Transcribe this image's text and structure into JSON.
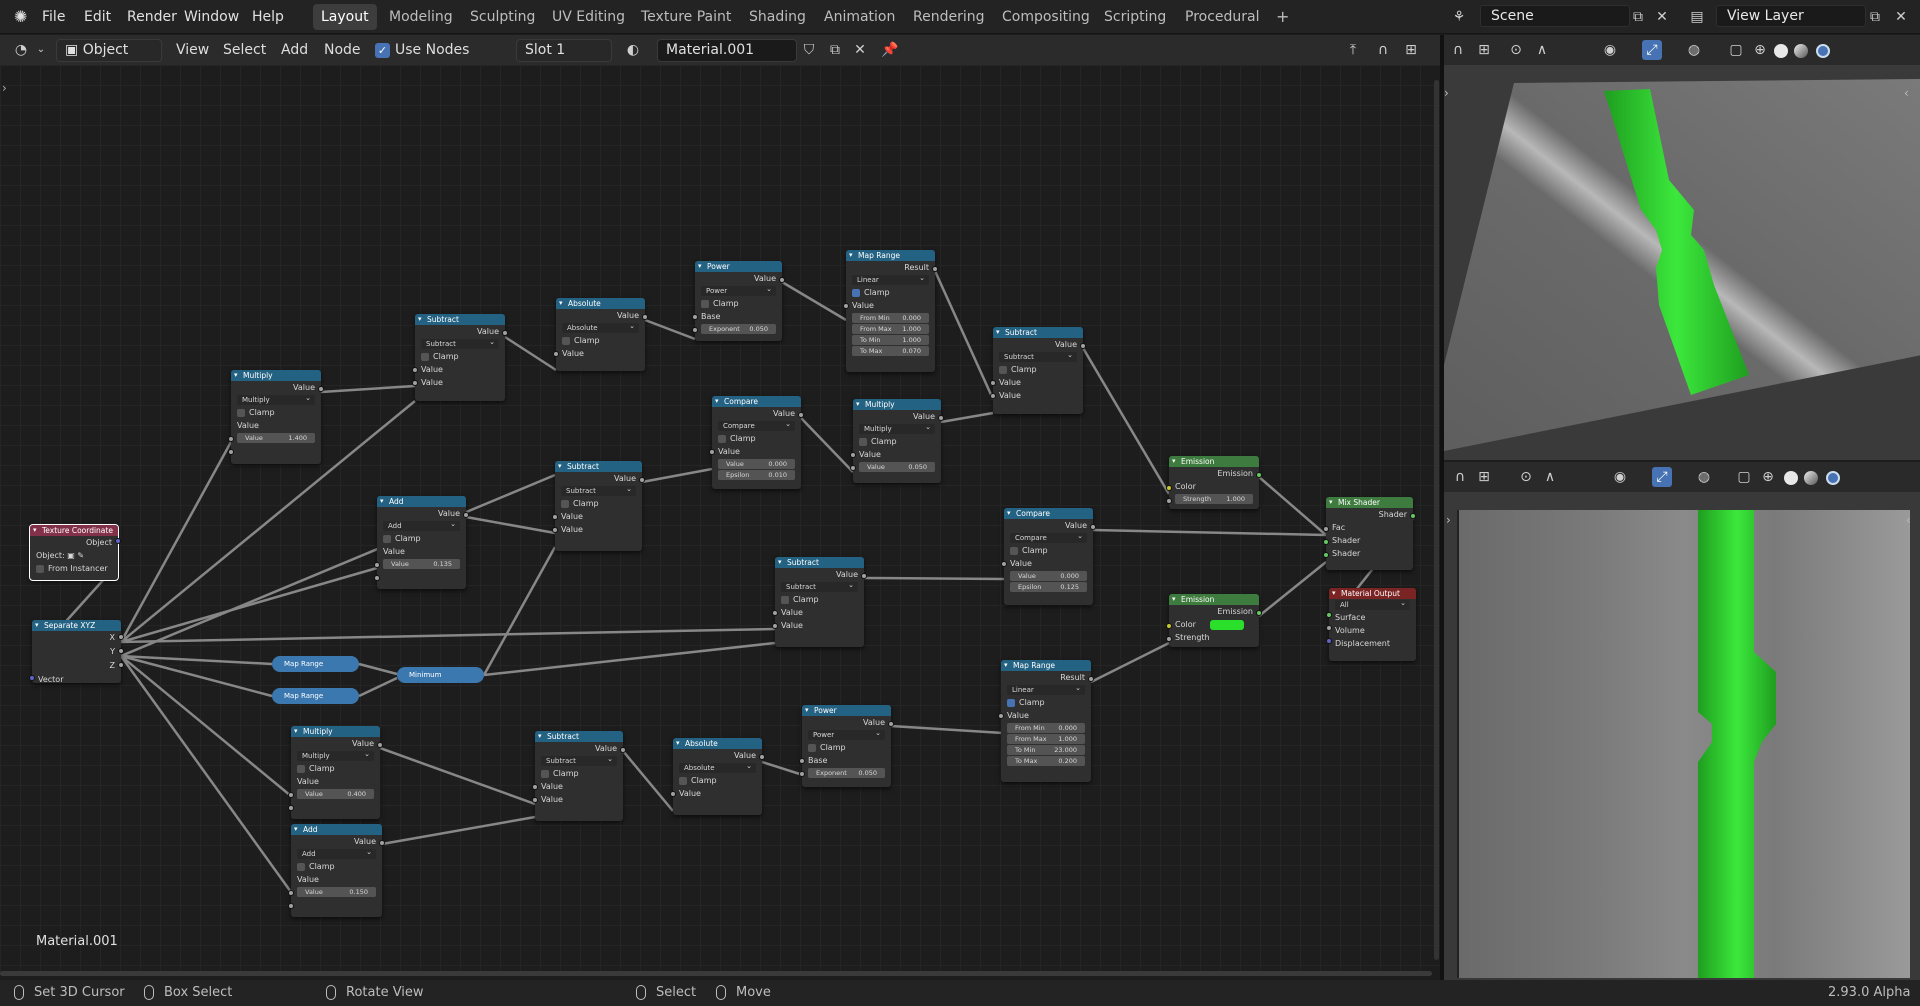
{
  "menubar": {
    "items": [
      "File",
      "Edit",
      "Render",
      "Window",
      "Help"
    ],
    "workspaces": [
      "Layout",
      "Modeling",
      "Sculpting",
      "UV Editing",
      "Texture Paint",
      "Shading",
      "Animation",
      "Rendering",
      "Compositing",
      "Scripting",
      "Procedural"
    ],
    "active_workspace": "Layout",
    "add_workspace": "+",
    "scene": "Scene",
    "view_layer": "View Layer"
  },
  "node_header": {
    "object_mode": "Object",
    "menus": [
      "View",
      "Select",
      "Add",
      "Node"
    ],
    "use_nodes_label": "Use Nodes",
    "slot": "Slot 1",
    "material": "Material.001"
  },
  "canvas": {
    "material_label": "Material.001"
  },
  "nodes": {
    "texcoord": {
      "title": "Texture Coordinate",
      "out": "Object",
      "obj_label": "Object:",
      "from_instancer": "From Instancer"
    },
    "sepxyz": {
      "title": "Separate XYZ",
      "outs": [
        "X",
        "Y",
        "Z"
      ],
      "in": "Vector"
    },
    "mul1": {
      "title": "Multiply",
      "out": "Value",
      "op": "Multiply",
      "clamp": "Clamp",
      "in": "Value",
      "field_label": "Value",
      "field_value": "1.400"
    },
    "add1": {
      "title": "Add",
      "out": "Value",
      "op": "Add",
      "clamp": "Clamp",
      "in": "Value",
      "field_label": "Value",
      "field_value": "0.135"
    },
    "sub1": {
      "title": "Subtract",
      "out": "Value",
      "op": "Subtract",
      "clamp": "Clamp",
      "in1": "Value",
      "in2": "Value"
    },
    "abs1": {
      "title": "Absolute",
      "out": "Value",
      "op": "Absolute",
      "clamp": "Clamp",
      "in": "Value"
    },
    "pow1": {
      "title": "Power",
      "out": "Value",
      "op": "Power",
      "clamp": "Clamp",
      "in": "Base",
      "field_label": "Exponent",
      "field_value": "0.050"
    },
    "maprange1": {
      "title": "Map Range",
      "out": "Result",
      "op": "Linear",
      "clamp": "Clamp",
      "in": "Value",
      "fields": [
        [
          "From Min",
          "0.000"
        ],
        [
          "From Max",
          "1.000"
        ],
        [
          "To Min",
          "1.000"
        ],
        [
          "To Max",
          "0.070"
        ]
      ]
    },
    "sub2": {
      "title": "Subtract",
      "out": "Value",
      "op": "Subtract",
      "clamp": "Clamp",
      "in1": "Value",
      "in2": "Value"
    },
    "cmp1": {
      "title": "Compare",
      "out": "Value",
      "op": "Compare",
      "clamp": "Clamp",
      "in": "Value",
      "fields": [
        [
          "Value",
          "0.000"
        ],
        [
          "Epsilon",
          "0.010"
        ]
      ]
    },
    "mul2": {
      "title": "Multiply",
      "out": "Value",
      "op": "Multiply",
      "clamp": "Clamp",
      "in": "Value",
      "field_label": "Value",
      "field_value": "0.050"
    },
    "sub3": {
      "title": "Subtract",
      "out": "Value",
      "op": "Subtract",
      "clamp": "Clamp",
      "in1": "Value",
      "in2": "Value"
    },
    "sub4": {
      "title": "Subtract",
      "out": "Value",
      "op": "Subtract",
      "clamp": "Clamp",
      "in1": "Value",
      "in2": "Value"
    },
    "cmp2": {
      "title": "Compare",
      "out": "Value",
      "op": "Compare",
      "clamp": "Clamp",
      "in": "Value",
      "fields": [
        [
          "Value",
          "0.000"
        ],
        [
          "Epsilon",
          "0.125"
        ]
      ]
    },
    "emis1": {
      "title": "Emission",
      "out": "Emission",
      "color": "Color",
      "strength_label": "Strength",
      "strength_value": "1.000"
    },
    "emis2": {
      "title": "Emission",
      "out": "Emission",
      "color": "Color",
      "strength": "Strength"
    },
    "mix": {
      "title": "Mix Shader",
      "out": "Shader",
      "ins": [
        "Fac",
        "Shader",
        "Shader"
      ]
    },
    "matout": {
      "title": "Material Output",
      "target": "All",
      "ins": [
        "Surface",
        "Volume",
        "Displacement"
      ]
    },
    "reroute_map1": "Map Range",
    "reroute_map2": "Map Range",
    "reroute_min": "Minimum",
    "mul3": {
      "title": "Multiply",
      "out": "Value",
      "op": "Multiply",
      "clamp": "Clamp",
      "in": "Value",
      "field_label": "Value",
      "field_value": "0.400"
    },
    "add2": {
      "title": "Add",
      "out": "Value",
      "op": "Add",
      "clamp": "Clamp",
      "in": "Value",
      "field_label": "Value",
      "field_value": "0.150"
    },
    "sub5": {
      "title": "Subtract",
      "out": "Value",
      "op": "Subtract",
      "clamp": "Clamp",
      "in1": "Value",
      "in2": "Value"
    },
    "abs2": {
      "title": "Absolute",
      "out": "Value",
      "op": "Absolute",
      "clamp": "Clamp",
      "in": "Value"
    },
    "pow2": {
      "title": "Power",
      "out": "Value",
      "op": "Power",
      "clamp": "Clamp",
      "in": "Base",
      "field_label": "Exponent",
      "field_value": "0.050"
    },
    "maprange2": {
      "title": "Map Range",
      "out": "Result",
      "op": "Linear",
      "clamp": "Clamp",
      "in": "Value",
      "fields": [
        [
          "From Min",
          "0.000"
        ],
        [
          "From Max",
          "1.000"
        ],
        [
          "To Min",
          "23.000"
        ],
        [
          "To Max",
          "0.200"
        ]
      ]
    }
  },
  "statusbar": {
    "set_cursor": "Set 3D Cursor",
    "box_select": "Box Select",
    "rotate_view": "Rotate View",
    "select": "Select",
    "move": "Move",
    "version": "2.93.0 Alpha"
  },
  "colors": {
    "accent": "#4772b3",
    "emission_green": "#2be02b",
    "math_header": "#246283",
    "shader_header": "#3e7b3e",
    "output_header": "#7a2424",
    "input_header": "#83314a"
  }
}
